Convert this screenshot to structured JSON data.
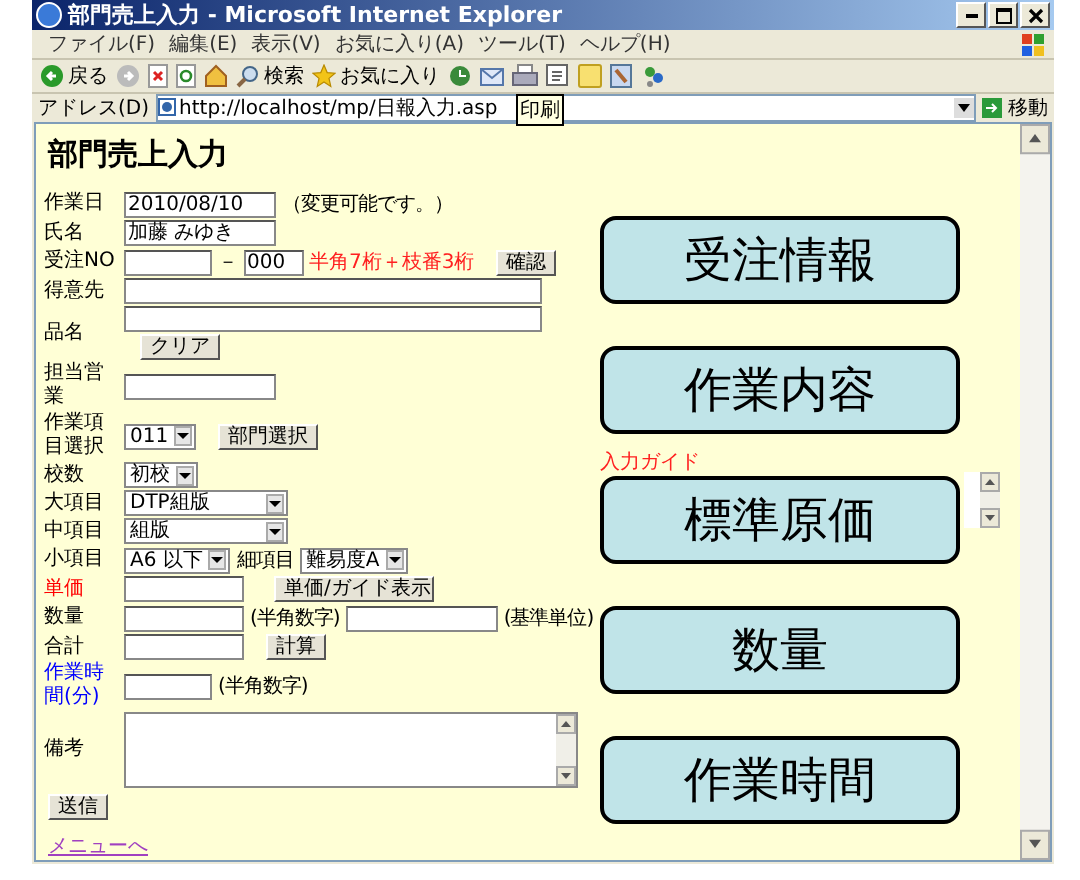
{
  "window": {
    "title": "部門売上入力 - Microsoft Internet Explorer"
  },
  "menu": [
    "ファイル(F)",
    "編集(E)",
    "表示(V)",
    "お気に入り(A)",
    "ツール(T)",
    "ヘルプ(H)"
  ],
  "toolbar": {
    "back": "戻る",
    "search": "検索",
    "favorites": "お気に入り",
    "tooltip": "印刷"
  },
  "address_bar": {
    "label": "アドレス(D)",
    "url": "http://localhost/mp/日報入力.asp",
    "go": "移動"
  },
  "page": {
    "heading": "部門売上入力",
    "rows": [
      {
        "label": "作業日",
        "color": "#000000",
        "lines": [
          [
            {
              "kind": "field",
              "value": "2010/08/10"
            },
            {
              "kind": "note",
              "text": "（変更可能です。）"
            }
          ]
        ]
      },
      {
        "label": "氏名",
        "color": "#000000",
        "lines": [
          [
            {
              "kind": "field",
              "value": "加藤 みゆき"
            }
          ]
        ]
      },
      {
        "label": "受注NO",
        "color": "#000000",
        "lines": [
          [
            {
              "kind": "short-field"
            },
            {
              "kind": "note",
              "text": "－"
            },
            {
              "kind": "tiny-field",
              "value": "000"
            },
            {
              "kind": "warning",
              "text": "半角7桁＋枝番3桁"
            },
            {
              "kind": "button",
              "text": "確認"
            }
          ]
        ]
      },
      {
        "label": "得意先",
        "color": "#000000",
        "lines": [
          [
            {
              "kind": "long-field"
            }
          ]
        ]
      },
      {
        "label": "品名",
        "color": "#000000",
        "lines": [
          [
            {
              "kind": "long-field"
            }
          ],
          [
            {
              "kind": "button",
              "text": "クリア"
            }
          ]
        ]
      },
      {
        "label": "担当営業",
        "color": "#000000",
        "lines": [
          [
            {
              "kind": "field"
            }
          ]
        ]
      },
      {
        "label": "作業項目選択",
        "color": "#000000",
        "lines": [
          [
            {
              "kind": "select",
              "value": "011"
            },
            {
              "kind": "button",
              "text": "部門選択"
            }
          ]
        ]
      },
      {
        "label": "校数",
        "color": "#000000",
        "lines": [
          [
            {
              "kind": "select",
              "value": "初校"
            }
          ]
        ]
      },
      {
        "label": "大項目",
        "color": "#000000",
        "lines": [
          [
            {
              "kind": "wide-select",
              "value": "DTP組版"
            }
          ]
        ]
      },
      {
        "label": "中項目",
        "color": "#000000",
        "lines": [
          [
            {
              "kind": "wide-select",
              "value": "組版"
            }
          ]
        ]
      },
      {
        "label": "小項目",
        "color": "#000000",
        "lines": [
          [
            {
              "kind": "select",
              "value": "A6 以下"
            },
            {
              "kind": "note",
              "text": "細項目"
            },
            {
              "kind": "select",
              "value": "難易度A"
            }
          ]
        ]
      },
      {
        "label": "単価",
        "color": "#ff0000",
        "lines": [
          [
            {
              "kind": "medium-field"
            },
            {
              "kind": "wide-button",
              "text": "単価/ガイド表示"
            }
          ]
        ]
      },
      {
        "label": "数量",
        "color": "#000000",
        "lines": [
          [
            {
              "kind": "medium-field"
            },
            {
              "kind": "note",
              "text": "(半角数字)"
            },
            {
              "kind": "field"
            },
            {
              "kind": "note",
              "text": "(基準単位)"
            }
          ]
        ]
      },
      {
        "label": "合計",
        "color": "#000000",
        "lines": [
          [
            {
              "kind": "medium-field"
            },
            {
              "kind": "button",
              "text": "計算"
            }
          ]
        ]
      },
      {
        "label": "作業時間(分)",
        "color": "#0000ff",
        "lines": [
          [
            {
              "kind": "short-field"
            },
            {
              "kind": "note",
              "text": "(半角数字)"
            }
          ]
        ]
      },
      {
        "label": "備考",
        "color": "#000000",
        "lines": [
          [
            {
              "kind": "textarea"
            }
          ]
        ]
      }
    ],
    "submit": "送信",
    "menu_link": "メニューへ",
    "guide_label": "入力ガイド",
    "callouts": [
      "受注情報",
      "作業内容",
      "標準原価",
      "数量",
      "作業時間"
    ]
  }
}
